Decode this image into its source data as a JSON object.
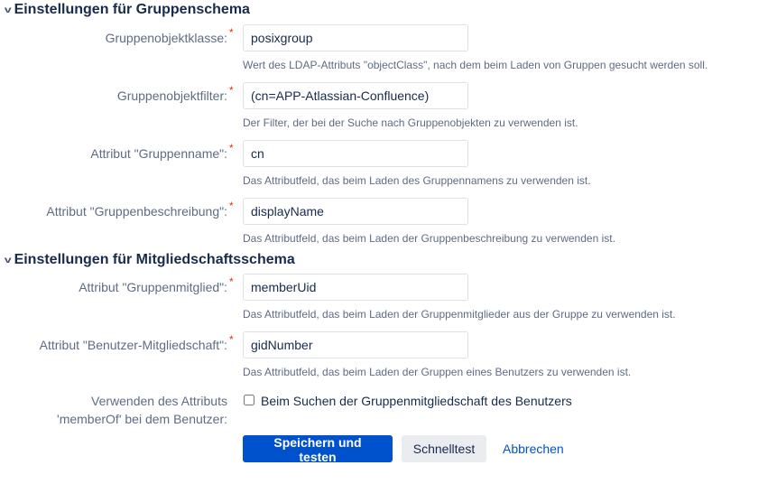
{
  "sections": [
    {
      "title": "Einstellungen für Gruppenschema"
    },
    {
      "title": "Einstellungen für Mitgliedschaftsschema"
    }
  ],
  "fields": [
    {
      "label": "Gruppenobjektklasse:",
      "value": "posixgroup",
      "help": "Wert des LDAP-Attributs \"objectClass\", nach dem beim Laden von Gruppen gesucht werden soll."
    },
    {
      "label": "Gruppenobjektfilter:",
      "value": "(cn=APP-Atlassian-Confluence)",
      "help": "Der Filter, der bei der Suche nach Gruppenobjekten zu verwenden ist."
    },
    {
      "label": "Attribut \"Gruppenname\":",
      "value": "cn",
      "help": "Das Attributfeld, das beim Laden des Gruppennamens zu verwenden ist."
    },
    {
      "label": "Attribut \"Gruppenbeschreibung\":",
      "value": "displayName",
      "help": "Das Attributfeld, das beim Laden der Gruppenbeschreibung zu verwenden ist."
    },
    {
      "label": "Attribut \"Gruppenmitglied\":",
      "value": "memberUid",
      "help": "Das Attributfeld, das beim Laden der Gruppenmitglieder aus der Gruppe zu verwenden ist."
    },
    {
      "label": "Attribut \"Benutzer-Mitgliedschaft\":",
      "value": "gidNumber",
      "help": "Das Attributfeld, das beim Laden der Gruppen eines Benutzers zu verwenden ist."
    }
  ],
  "required_mark": "*",
  "memberof": {
    "label_line1": "Verwenden des Attributs",
    "label_line2": "'memberOf' bei dem Benutzer:",
    "checkbox_label": "Beim Suchen der Gruppenmitgliedschaft des Benutzers",
    "checked": false
  },
  "buttons": {
    "save": "Speichern und testen",
    "quicktest": "Schnelltest",
    "cancel": "Abbrechen"
  }
}
